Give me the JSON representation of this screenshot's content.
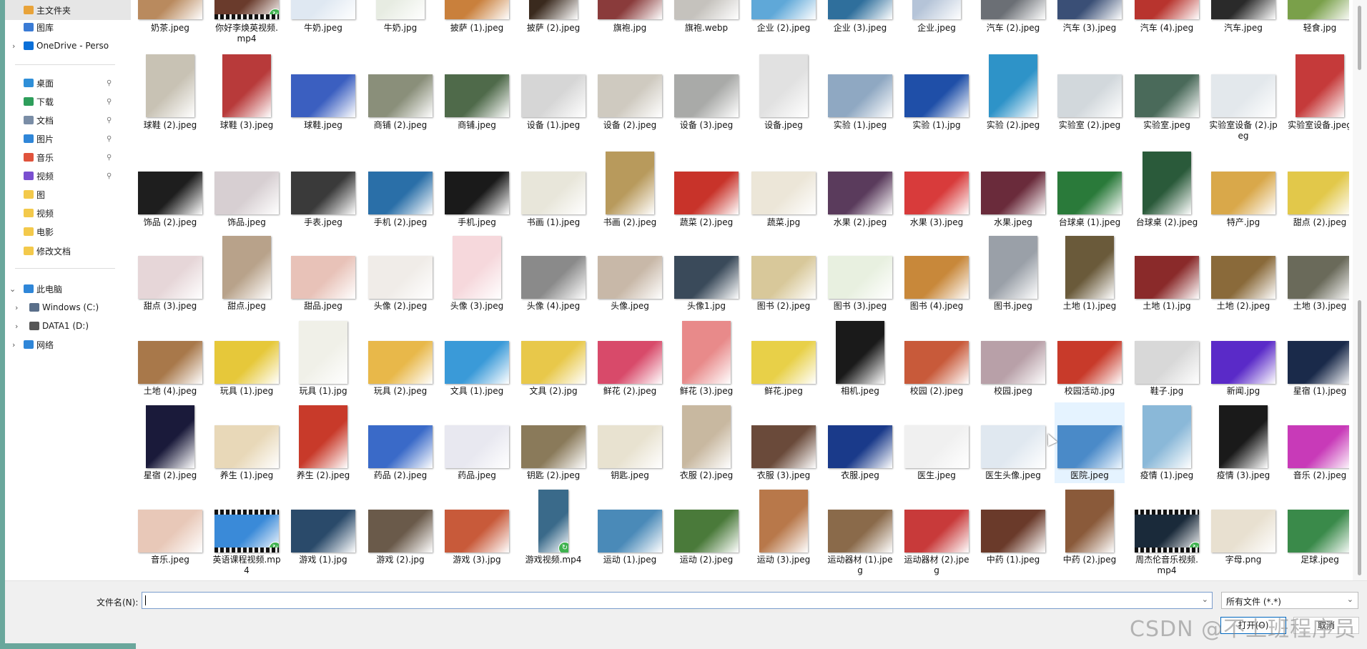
{
  "nav": {
    "items": [
      {
        "label": "主文件夹",
        "icon": "home-icon",
        "color": "#e8a33a",
        "pinned": false,
        "selected": true,
        "chevron": ""
      },
      {
        "label": "图库",
        "icon": "gallery-icon",
        "color": "#3a7bd5",
        "pinned": false,
        "selected": false,
        "chevron": ""
      },
      {
        "label": "OneDrive - Perso",
        "icon": "cloud-icon",
        "color": "#0a6fd8",
        "pinned": false,
        "selected": false,
        "chevron": "›"
      },
      {
        "label": "桌面",
        "icon": "desktop-icon",
        "color": "#2f8fd8",
        "pinned": true,
        "selected": false,
        "chevron": ""
      },
      {
        "label": "下载",
        "icon": "download-icon",
        "color": "#2e9e5b",
        "pinned": true,
        "selected": false,
        "chevron": ""
      },
      {
        "label": "文档",
        "icon": "document-icon",
        "color": "#7a8da6",
        "pinned": true,
        "selected": false,
        "chevron": ""
      },
      {
        "label": "图片",
        "icon": "picture-icon",
        "color": "#2f86d8",
        "pinned": true,
        "selected": false,
        "chevron": ""
      },
      {
        "label": "音乐",
        "icon": "music-icon",
        "color": "#e0533c",
        "pinned": true,
        "selected": false,
        "chevron": ""
      },
      {
        "label": "视频",
        "icon": "video-icon",
        "color": "#7a4fd0",
        "pinned": true,
        "selected": false,
        "chevron": ""
      },
      {
        "label": "图",
        "icon": "folder-icon",
        "color": "#f3c94b",
        "pinned": false,
        "selected": false,
        "chevron": ""
      },
      {
        "label": "视频",
        "icon": "folder-icon",
        "color": "#f3c94b",
        "pinned": false,
        "selected": false,
        "chevron": ""
      },
      {
        "label": "电影",
        "icon": "folder-icon",
        "color": "#f3c94b",
        "pinned": false,
        "selected": false,
        "chevron": ""
      },
      {
        "label": "修改文档",
        "icon": "folder-icon",
        "color": "#f3c94b",
        "pinned": false,
        "selected": false,
        "chevron": ""
      },
      {
        "label": "此电脑",
        "icon": "computer-icon",
        "color": "#2f86d8",
        "pinned": false,
        "selected": false,
        "chevron": "⌄"
      },
      {
        "label": "Windows (C:)",
        "icon": "drive-icon",
        "color": "#5a6f8a",
        "pinned": false,
        "selected": false,
        "chevron": "›"
      },
      {
        "label": "DATA1 (D:)",
        "icon": "drive-icon",
        "color": "#555555",
        "pinned": false,
        "selected": false,
        "chevron": "›"
      },
      {
        "label": "网络",
        "icon": "network-icon",
        "color": "#2f86d8",
        "pinned": false,
        "selected": false,
        "chevron": "›"
      }
    ]
  },
  "files": [
    {
      "name": "奶茶.jpeg",
      "kind": "image",
      "color": "#b98a5e"
    },
    {
      "name": "你好李焕英视频.mp4",
      "kind": "video",
      "color": "#6a3b2c"
    },
    {
      "name": "牛奶.jpeg",
      "kind": "image",
      "color": "#dfe8f2"
    },
    {
      "name": "牛奶.jpg",
      "kind": "image",
      "color": "#e7ece2"
    },
    {
      "name": "披萨 (1).jpeg",
      "kind": "image",
      "color": "#c9803c"
    },
    {
      "name": "披萨 (2).jpeg",
      "kind": "image",
      "color": "#3a2a1e"
    },
    {
      "name": "旗袍.jpg",
      "kind": "image",
      "color": "#8a3b3b"
    },
    {
      "name": "旗袍.webp",
      "kind": "image",
      "color": "#c5c2bd"
    },
    {
      "name": "企业 (2).jpeg",
      "kind": "image",
      "color": "#5fa8d8"
    },
    {
      "name": "企业 (3).jpeg",
      "kind": "image",
      "color": "#2f6f9c"
    },
    {
      "name": "企业.jpeg",
      "kind": "image",
      "color": "#b5c4d8"
    },
    {
      "name": "汽车 (2).jpeg",
      "kind": "image",
      "color": "#6b6f75"
    },
    {
      "name": "汽车 (3).jpeg",
      "kind": "image",
      "color": "#3a4f76"
    },
    {
      "name": "汽车 (4).jpeg",
      "kind": "image",
      "color": "#b8342e"
    },
    {
      "name": "汽车.jpeg",
      "kind": "image",
      "color": "#2a2a2a"
    },
    {
      "name": "轻食.jpg",
      "kind": "image",
      "color": "#7aa04a"
    },
    {
      "name": "球鞋 (2).jpeg",
      "kind": "image",
      "color": "#c8c2b4"
    },
    {
      "name": "球鞋 (3).jpeg",
      "kind": "image",
      "color": "#b83a3a"
    },
    {
      "name": "球鞋.jpeg",
      "kind": "image",
      "color": "#3b5fc0"
    },
    {
      "name": "商铺 (2).jpeg",
      "kind": "image",
      "color": "#8a8f7a"
    },
    {
      "name": "商铺.jpeg",
      "kind": "image",
      "color": "#4f6a4a"
    },
    {
      "name": "设备 (1).jpeg",
      "kind": "image",
      "color": "#d6d6d6"
    },
    {
      "name": "设备 (2).jpeg",
      "kind": "image",
      "color": "#cfcac0"
    },
    {
      "name": "设备 (3).jpeg",
      "kind": "image",
      "color": "#a9aaa8"
    },
    {
      "name": "设备.jpeg",
      "kind": "image",
      "color": "#e1e1e1"
    },
    {
      "name": "实验 (1).jpeg",
      "kind": "image",
      "color": "#8fa8c2"
    },
    {
      "name": "实验 (1).jpg",
      "kind": "image",
      "color": "#1f4fa8"
    },
    {
      "name": "实验 (2).jpeg",
      "kind": "image",
      "color": "#2e93c8"
    },
    {
      "name": "实验室 (2).jpeg",
      "kind": "image",
      "color": "#d2d8dc"
    },
    {
      "name": "实验室.jpeg",
      "kind": "image",
      "color": "#4a6a5a"
    },
    {
      "name": "实验室设备 (2).jpeg",
      "kind": "image",
      "color": "#e3e8ec"
    },
    {
      "name": "实验室设备.jpeg",
      "kind": "image",
      "color": "#c53a3a"
    },
    {
      "name": "饰品 (2).jpeg",
      "kind": "image",
      "color": "#1e1e1e"
    },
    {
      "name": "饰品.jpeg",
      "kind": "image",
      "color": "#d7cfd2"
    },
    {
      "name": "手表.jpeg",
      "kind": "image",
      "color": "#3a3a3a"
    },
    {
      "name": "手机 (2).jpeg",
      "kind": "image",
      "color": "#2a6fa8"
    },
    {
      "name": "手机.jpeg",
      "kind": "image",
      "color": "#1a1a1a"
    },
    {
      "name": "书画 (1).jpeg",
      "kind": "image",
      "color": "#e8e6da"
    },
    {
      "name": "书画 (2).jpeg",
      "kind": "image",
      "color": "#b89a5c"
    },
    {
      "name": "蔬菜 (2).jpeg",
      "kind": "image",
      "color": "#c8332a"
    },
    {
      "name": "蔬菜.jpg",
      "kind": "image",
      "color": "#ece6d8"
    },
    {
      "name": "水果 (2).jpeg",
      "kind": "image",
      "color": "#5a3b5c"
    },
    {
      "name": "水果 (3).jpeg",
      "kind": "image",
      "color": "#d83b3b"
    },
    {
      "name": "水果.jpeg",
      "kind": "image",
      "color": "#6a2b3b"
    },
    {
      "name": "台球桌 (1).jpeg",
      "kind": "image",
      "color": "#2a7a3a"
    },
    {
      "name": "台球桌 (2).jpeg",
      "kind": "image",
      "color": "#2a5a3a"
    },
    {
      "name": "特产.jpg",
      "kind": "image",
      "color": "#d9a84a"
    },
    {
      "name": "甜点 (2).jpeg",
      "kind": "image",
      "color": "#e2c84a"
    },
    {
      "name": "甜点 (3).jpeg",
      "kind": "image",
      "color": "#e6d6d8"
    },
    {
      "name": "甜点.jpeg",
      "kind": "image",
      "color": "#b8a28a"
    },
    {
      "name": "甜品.jpeg",
      "kind": "image",
      "color": "#e8c2b8"
    },
    {
      "name": "头像 (2).jpeg",
      "kind": "image",
      "color": "#f0ece8"
    },
    {
      "name": "头像 (3).jpeg",
      "kind": "image",
      "color": "#f6d8dc"
    },
    {
      "name": "头像 (4).jpeg",
      "kind": "image",
      "color": "#8a8a8a"
    },
    {
      "name": "头像.jpeg",
      "kind": "image",
      "color": "#c8b8a8"
    },
    {
      "name": "头像1.jpg",
      "kind": "image",
      "color": "#3a4a5a"
    },
    {
      "name": "图书 (2).jpeg",
      "kind": "image",
      "color": "#d8c89a"
    },
    {
      "name": "图书 (3).jpeg",
      "kind": "image",
      "color": "#e8f0e0"
    },
    {
      "name": "图书 (4).jpeg",
      "kind": "image",
      "color": "#c8883a"
    },
    {
      "name": "图书.jpeg",
      "kind": "image",
      "color": "#9aa0a8"
    },
    {
      "name": "土地 (1).jpeg",
      "kind": "image",
      "color": "#6a5a3a"
    },
    {
      "name": "土地 (1).jpg",
      "kind": "image",
      "color": "#8a2a2a"
    },
    {
      "name": "土地 (2).jpeg",
      "kind": "image",
      "color": "#8a6a3a"
    },
    {
      "name": "土地 (3).jpeg",
      "kind": "image",
      "color": "#6a6a5a"
    },
    {
      "name": "土地 (4).jpeg",
      "kind": "image",
      "color": "#a8784a"
    },
    {
      "name": "玩具 (1).jpeg",
      "kind": "image",
      "color": "#e6c83a"
    },
    {
      "name": "玩具 (1).jpg",
      "kind": "image",
      "color": "#f0f0e8"
    },
    {
      "name": "玩具 (2).jpeg",
      "kind": "image",
      "color": "#e8b84a"
    },
    {
      "name": "文具 (1).jpeg",
      "kind": "image",
      "color": "#3a9ad8"
    },
    {
      "name": "文具 (2).jpg",
      "kind": "image",
      "color": "#e8c84a"
    },
    {
      "name": "鲜花 (2).jpeg",
      "kind": "image",
      "color": "#d84a6a"
    },
    {
      "name": "鲜花 (3).jpeg",
      "kind": "image",
      "color": "#e88a8a"
    },
    {
      "name": "鲜花.jpeg",
      "kind": "image",
      "color": "#e8d048"
    },
    {
      "name": "相机.jpeg",
      "kind": "image",
      "color": "#1a1a1a"
    },
    {
      "name": "校园 (2).jpeg",
      "kind": "image",
      "color": "#c85a3a"
    },
    {
      "name": "校园.jpeg",
      "kind": "image",
      "color": "#b8a0a8"
    },
    {
      "name": "校园活动.jpg",
      "kind": "image",
      "color": "#c83a2a"
    },
    {
      "name": "鞋子.jpg",
      "kind": "image",
      "color": "#d8d8d8"
    },
    {
      "name": "新闻.jpg",
      "kind": "image",
      "color": "#5a2ac8"
    },
    {
      "name": "星宿 (1).jpeg",
      "kind": "image",
      "color": "#1a2a4a"
    },
    {
      "name": "星宿 (2).jpeg",
      "kind": "image",
      "color": "#1a1a3a"
    },
    {
      "name": "养生 (1).jpeg",
      "kind": "image",
      "color": "#e8d8b8"
    },
    {
      "name": "养生 (2).jpeg",
      "kind": "image",
      "color": "#c83a2a"
    },
    {
      "name": "药品 (2).jpeg",
      "kind": "image",
      "color": "#3a6ac8"
    },
    {
      "name": "药品.jpeg",
      "kind": "image",
      "color": "#e8e8f0"
    },
    {
      "name": "钥匙 (2).jpeg",
      "kind": "image",
      "color": "#8a7a5a"
    },
    {
      "name": "钥匙.jpeg",
      "kind": "image",
      "color": "#e8e2d0"
    },
    {
      "name": "衣服 (2).jpeg",
      "kind": "image",
      "color": "#c8b8a0"
    },
    {
      "name": "衣服 (3).jpeg",
      "kind": "image",
      "color": "#6a4a3a"
    },
    {
      "name": "衣服.jpeg",
      "kind": "image",
      "color": "#1a3a8a"
    },
    {
      "name": "医生.jpeg",
      "kind": "image",
      "color": "#f0f0f0"
    },
    {
      "name": "医生头像.jpeg",
      "kind": "image",
      "color": "#e0e8f0"
    },
    {
      "name": "医院.jpeg",
      "kind": "image",
      "color": "#4a8ac8",
      "hover": true
    },
    {
      "name": "疫情 (1).jpeg",
      "kind": "image",
      "color": "#8ab8d8"
    },
    {
      "name": "疫情 (3).jpeg",
      "kind": "image",
      "color": "#1a1a1a"
    },
    {
      "name": "音乐 (2).jpeg",
      "kind": "image",
      "color": "#c83ab8"
    },
    {
      "name": "音乐.jpeg",
      "kind": "image",
      "color": "#e8c8b8"
    },
    {
      "name": "英语课程视频.mp4",
      "kind": "video",
      "color": "#3a8ad8"
    },
    {
      "name": "游戏 (1).jpg",
      "kind": "image",
      "color": "#2a4a6a"
    },
    {
      "name": "游戏 (2).jpg",
      "kind": "image",
      "color": "#6a5a4a"
    },
    {
      "name": "游戏 (3).jpg",
      "kind": "image",
      "color": "#c85a3a"
    },
    {
      "name": "游戏视频.mp4",
      "kind": "video-single",
      "color": "#3a6a8a"
    },
    {
      "name": "运动 (1).jpeg",
      "kind": "image",
      "color": "#4a8ab8"
    },
    {
      "name": "运动 (2).jpeg",
      "kind": "image",
      "color": "#4a7a3a"
    },
    {
      "name": "运动 (3).jpeg",
      "kind": "image",
      "color": "#b8784a"
    },
    {
      "name": "运动器材 (1).jpeg",
      "kind": "image",
      "color": "#8a6a4a"
    },
    {
      "name": "运动器材 (2).jpeg",
      "kind": "image",
      "color": "#c83a3a"
    },
    {
      "name": "中药 (1).jpeg",
      "kind": "image",
      "color": "#6a3a2a"
    },
    {
      "name": "中药 (2).jpeg",
      "kind": "image",
      "color": "#8a5a3a"
    },
    {
      "name": "周杰伦音乐视频.mp4",
      "kind": "video",
      "color": "#1a2a3a"
    },
    {
      "name": "字母.png",
      "kind": "image",
      "color": "#e8e0d0"
    },
    {
      "name": "足球.jpeg",
      "kind": "image",
      "color": "#3a8a4a"
    }
  ],
  "bottom": {
    "filename_label": "文件名(N):",
    "filename_value": "",
    "filetype_value": "所有文件 (*.*)",
    "open_label": "打开(O)",
    "cancel_label": "取消"
  },
  "watermark": "CSDN @不上班程序员"
}
